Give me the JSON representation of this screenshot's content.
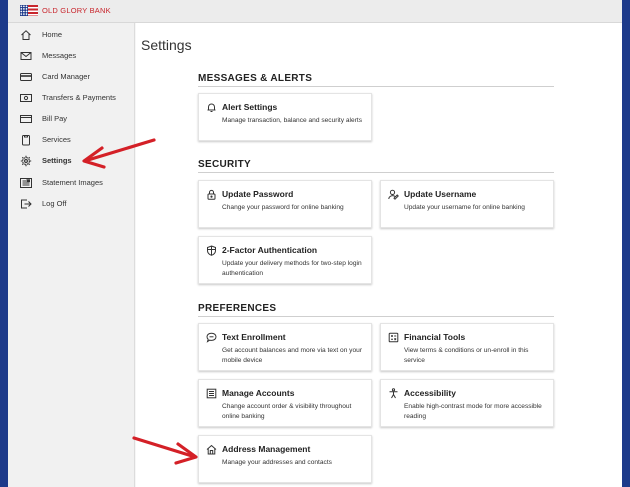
{
  "brand": {
    "name": "OLD GLORY BANK"
  },
  "page": {
    "title": "Settings"
  },
  "colors": {
    "accent": "#1d3a8a",
    "brand_red": "#c8252c",
    "arrow_red": "#d42027"
  },
  "sidebar": {
    "items": [
      {
        "label": "Home",
        "icon": "home-icon",
        "active": false
      },
      {
        "label": "Messages",
        "icon": "envelope-icon",
        "active": false
      },
      {
        "label": "Card Manager",
        "icon": "credit-card-icon",
        "active": false
      },
      {
        "label": "Transfers & Payments",
        "icon": "transfer-icon",
        "active": false
      },
      {
        "label": "Bill Pay",
        "icon": "bill-icon",
        "active": false
      },
      {
        "label": "Services",
        "icon": "clipboard-icon",
        "active": false
      },
      {
        "label": "Settings",
        "icon": "gear-icon",
        "active": true
      },
      {
        "label": "Statement Images",
        "icon": "statement-icon",
        "active": false
      },
      {
        "label": "Log Off",
        "icon": "logout-icon",
        "active": false
      }
    ]
  },
  "sections": [
    {
      "title": "MESSAGES & ALERTS",
      "cards": [
        {
          "title": "Alert Settings",
          "description": "Manage transaction, balance and security alerts",
          "icon": "bell-icon"
        }
      ]
    },
    {
      "title": "SECURITY",
      "cards": [
        {
          "title": "Update Password",
          "description": "Change your password for online banking",
          "icon": "lock-icon"
        },
        {
          "title": "Update Username",
          "description": "Update your username for online banking",
          "icon": "user-edit-icon"
        },
        {
          "title": "2-Factor Authentication",
          "description": "Update your delivery methods for two-step login authentication",
          "icon": "shield-icon"
        }
      ]
    },
    {
      "title": "PREFERENCES",
      "cards": [
        {
          "title": "Text Enrollment",
          "description": "Get account balances and more via text on your mobile device",
          "icon": "chat-icon"
        },
        {
          "title": "Financial Tools",
          "description": "View terms & conditions or un-enroll in this service",
          "icon": "tools-icon"
        },
        {
          "title": "Manage Accounts",
          "description": "Change account order & visibility throughout online banking",
          "icon": "accounts-icon"
        },
        {
          "title": "Accessibility",
          "description": "Enable high-contrast mode for more accessible reading",
          "icon": "accessibility-icon"
        },
        {
          "title": "Address Management",
          "description": "Manage your addresses and contacts",
          "icon": "house-icon"
        }
      ]
    }
  ]
}
